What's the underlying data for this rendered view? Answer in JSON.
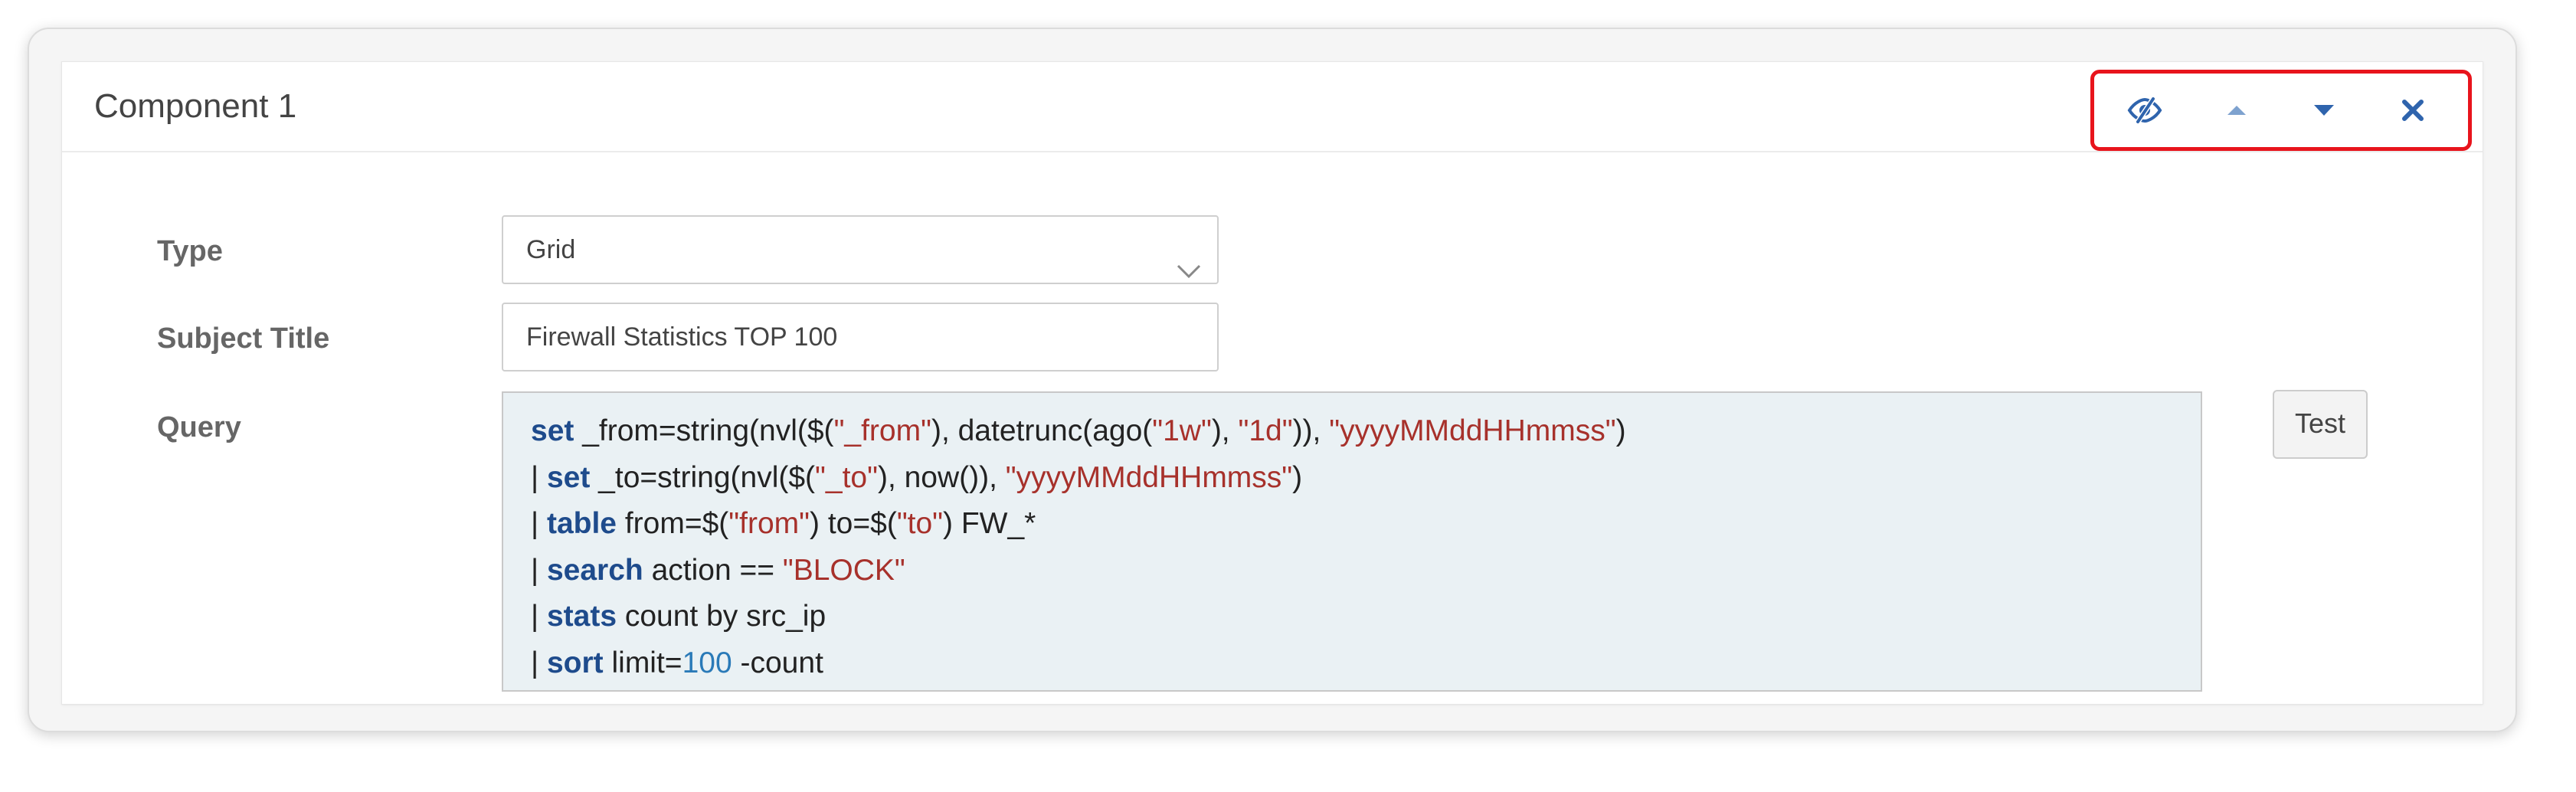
{
  "component": {
    "title": "Component 1"
  },
  "toolbar": {
    "icons": [
      "eye-slash-icon",
      "caret-up-icon",
      "caret-down-icon",
      "close-icon"
    ],
    "icon_color": "#2f64ad",
    "highlight_color": "#e8141c"
  },
  "form": {
    "type_label": "Type",
    "type_value": "Grid",
    "subject_label": "Subject Title",
    "subject_value": "Firewall Statistics TOP 100",
    "query_label": "Query",
    "test_button": "Test"
  },
  "query": {
    "lines": [
      [
        {
          "t": "set",
          "c": "kw"
        },
        {
          "t": " _from=string(nvl($(",
          "c": ""
        },
        {
          "t": "\"_from\"",
          "c": "str"
        },
        {
          "t": "), datetrunc(ago(",
          "c": ""
        },
        {
          "t": "\"1w\"",
          "c": "str"
        },
        {
          "t": "), ",
          "c": ""
        },
        {
          "t": "\"1d\"",
          "c": "str"
        },
        {
          "t": ")), ",
          "c": ""
        },
        {
          "t": "\"yyyyMMddHHmmss\"",
          "c": "str"
        },
        {
          "t": ")",
          "c": ""
        }
      ],
      [
        {
          "t": "| ",
          "c": ""
        },
        {
          "t": "set",
          "c": "kw"
        },
        {
          "t": " _to=string(nvl($(",
          "c": ""
        },
        {
          "t": "\"_to\"",
          "c": "str"
        },
        {
          "t": "), now()), ",
          "c": ""
        },
        {
          "t": "\"yyyyMMddHHmmss\"",
          "c": "str"
        },
        {
          "t": ")",
          "c": ""
        }
      ],
      [
        {
          "t": "| ",
          "c": ""
        },
        {
          "t": "table",
          "c": "kw"
        },
        {
          "t": " from=$(",
          "c": ""
        },
        {
          "t": "\"from\"",
          "c": "str"
        },
        {
          "t": ") to=$(",
          "c": ""
        },
        {
          "t": "\"to\"",
          "c": "str"
        },
        {
          "t": ") FW_*",
          "c": ""
        }
      ],
      [
        {
          "t": "| ",
          "c": ""
        },
        {
          "t": "search",
          "c": "kw"
        },
        {
          "t": " action == ",
          "c": ""
        },
        {
          "t": "\"BLOCK\"",
          "c": "str"
        }
      ],
      [
        {
          "t": "| ",
          "c": ""
        },
        {
          "t": "stats",
          "c": "kw"
        },
        {
          "t": " count by src_ip",
          "c": ""
        }
      ],
      [
        {
          "t": "| ",
          "c": ""
        },
        {
          "t": "sort",
          "c": "kw"
        },
        {
          "t": " limit=",
          "c": ""
        },
        {
          "t": "100",
          "c": "num"
        },
        {
          "t": " -count",
          "c": ""
        }
      ]
    ]
  }
}
